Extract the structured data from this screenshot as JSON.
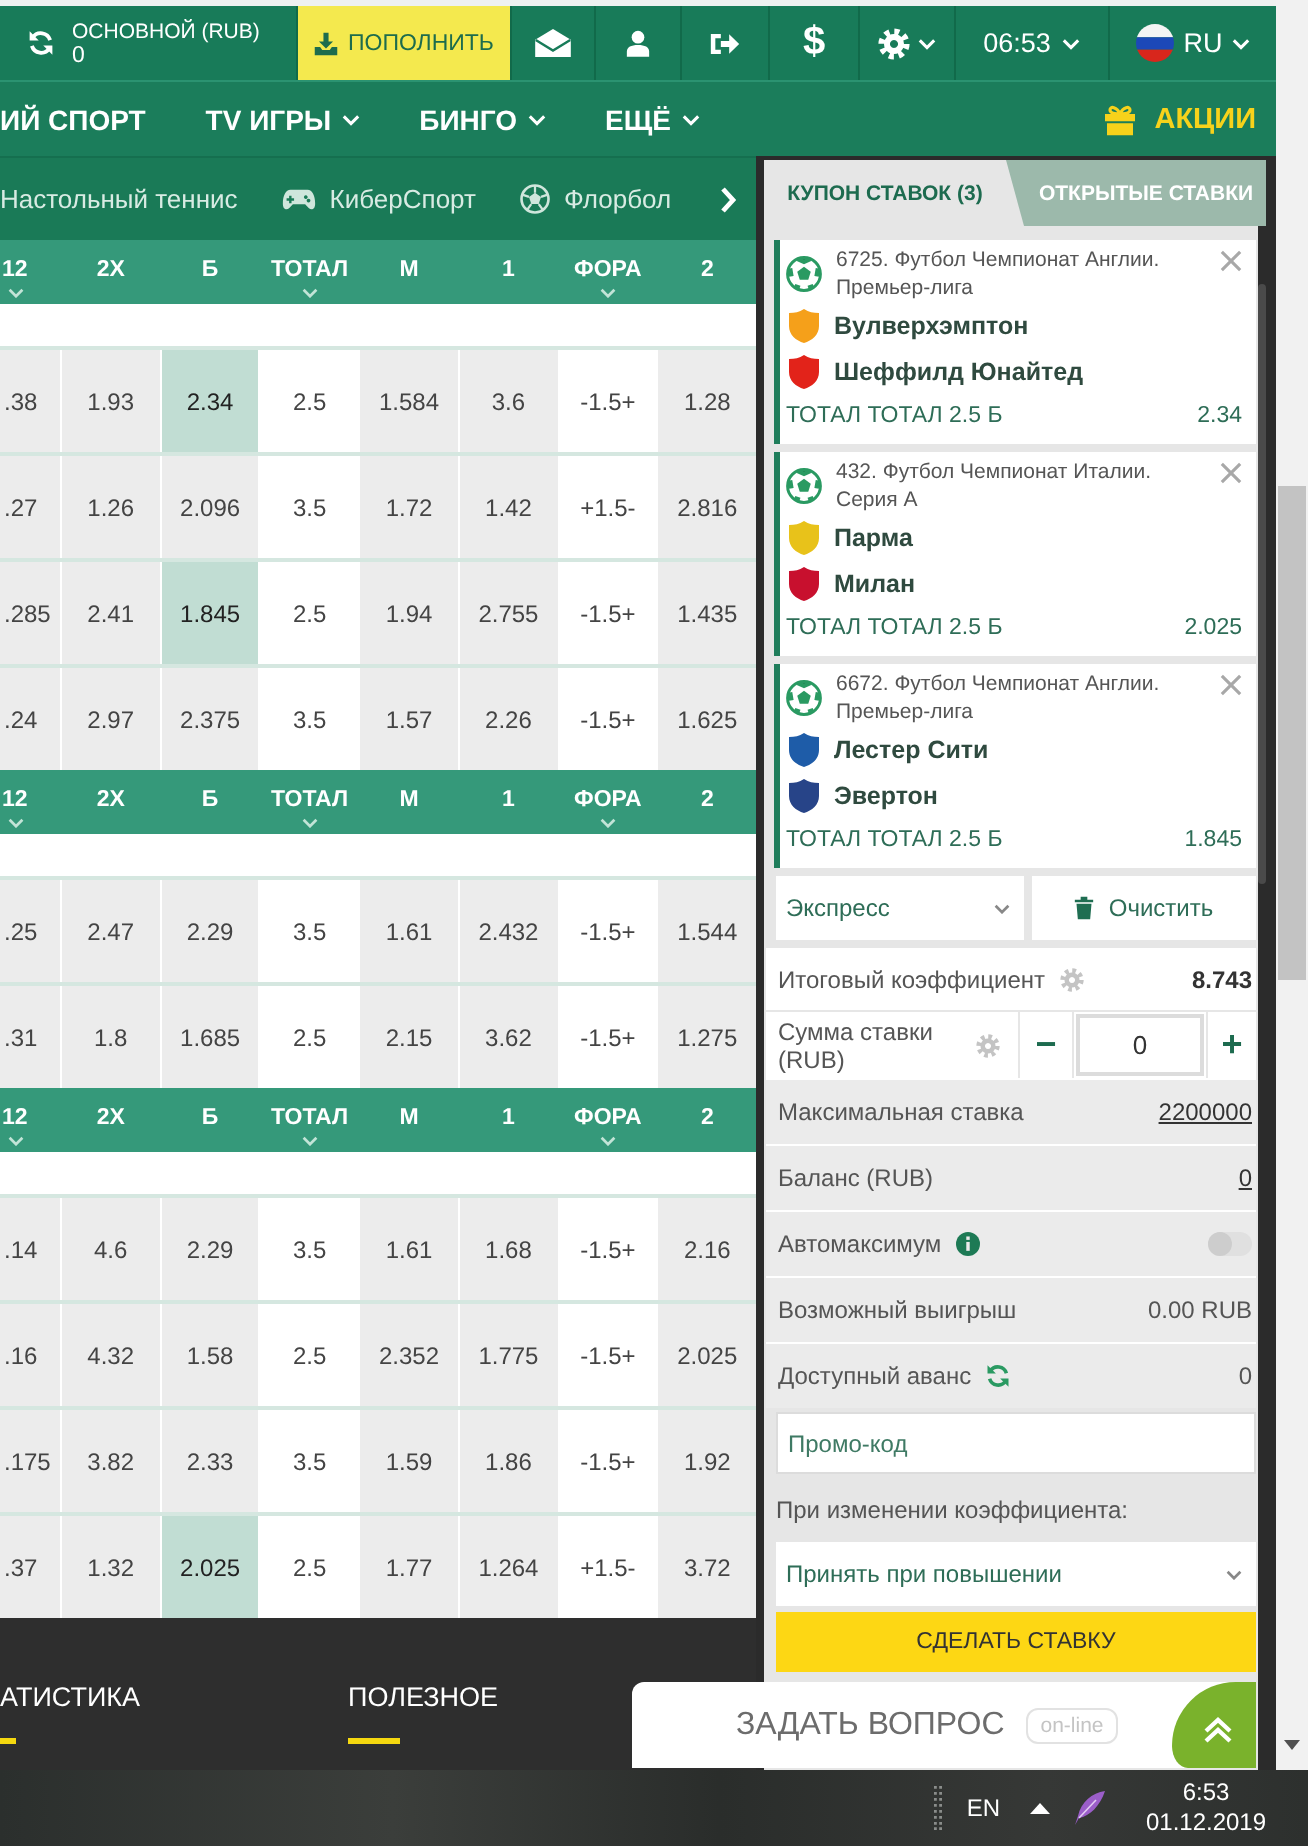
{
  "header": {
    "balance_label": "ОСНОВНОЙ (RUB)",
    "balance": "0",
    "deposit_button": "ПОПОЛНИТЬ",
    "cashier_button": "$",
    "time": "06:53",
    "language": "RU"
  },
  "nav": {
    "items": [
      {
        "label": "ИЙ СПОРТ",
        "dropdown": false
      },
      {
        "label": "TV ИГРЫ",
        "dropdown": true
      },
      {
        "label": "БИНГО",
        "dropdown": true
      },
      {
        "label": "ЕЩЁ",
        "dropdown": true
      }
    ],
    "promotions": "АКЦИИ"
  },
  "sports_tabs": [
    {
      "label": "Настольный теннис"
    },
    {
      "label": "КиберСпорт"
    },
    {
      "label": "Флорбол"
    }
  ],
  "odds_table": {
    "groups": [
      {
        "columns": [
          {
            "label": "12",
            "kind": "odds",
            "dropdown": true
          },
          {
            "label": "2X",
            "kind": "odds",
            "dropdown": false
          },
          {
            "label": "Б",
            "kind": "odds",
            "dropdown": false
          },
          {
            "label": "ТОТАЛ",
            "kind": "param",
            "dropdown": true
          },
          {
            "label": "М",
            "kind": "odds",
            "dropdown": false
          },
          {
            "label": "1",
            "kind": "odds",
            "dropdown": false
          },
          {
            "label": "ФОРА",
            "kind": "param",
            "dropdown": true
          },
          {
            "label": "2",
            "kind": "odds",
            "dropdown": false
          }
        ],
        "rows": [
          {
            "cells": [
              {
                "value": ".38",
                "selected": false
              },
              {
                "value": "1.93",
                "selected": false
              },
              {
                "value": "2.34",
                "selected": true
              },
              {
                "value": "2.5"
              },
              {
                "value": "1.584",
                "selected": false
              },
              {
                "value": "3.6",
                "selected": false
              },
              {
                "value": "-1.5+"
              },
              {
                "value": "1.28",
                "selected": false
              }
            ]
          },
          {
            "cells": [
              {
                "value": ".27",
                "selected": false
              },
              {
                "value": "1.26",
                "selected": false
              },
              {
                "value": "2.096",
                "selected": false
              },
              {
                "value": "3.5"
              },
              {
                "value": "1.72",
                "selected": false
              },
              {
                "value": "1.42",
                "selected": false
              },
              {
                "value": "+1.5-"
              },
              {
                "value": "2.816",
                "selected": false
              }
            ]
          },
          {
            "cells": [
              {
                "value": ".285",
                "selected": false
              },
              {
                "value": "2.41",
                "selected": false
              },
              {
                "value": "1.845",
                "selected": true
              },
              {
                "value": "2.5"
              },
              {
                "value": "1.94",
                "selected": false
              },
              {
                "value": "2.755",
                "selected": false
              },
              {
                "value": "-1.5+"
              },
              {
                "value": "1.435",
                "selected": false
              }
            ]
          },
          {
            "cells": [
              {
                "value": ".24",
                "selected": false
              },
              {
                "value": "2.97",
                "selected": false
              },
              {
                "value": "2.375",
                "selected": false
              },
              {
                "value": "3.5"
              },
              {
                "value": "1.57",
                "selected": false
              },
              {
                "value": "2.26",
                "selected": false
              },
              {
                "value": "-1.5+"
              },
              {
                "value": "1.625",
                "selected": false
              }
            ]
          }
        ]
      },
      {
        "columns": [
          {
            "label": "12",
            "kind": "odds",
            "dropdown": true
          },
          {
            "label": "2X",
            "kind": "odds",
            "dropdown": false
          },
          {
            "label": "Б",
            "kind": "odds",
            "dropdown": false
          },
          {
            "label": "ТОТАЛ",
            "kind": "param",
            "dropdown": true
          },
          {
            "label": "М",
            "kind": "odds",
            "dropdown": false
          },
          {
            "label": "1",
            "kind": "odds",
            "dropdown": false
          },
          {
            "label": "ФОРА",
            "kind": "param",
            "dropdown": true
          },
          {
            "label": "2",
            "kind": "odds",
            "dropdown": false
          }
        ],
        "rows": [
          {
            "cells": [
              {
                "value": ".25",
                "selected": false
              },
              {
                "value": "2.47",
                "selected": false
              },
              {
                "value": "2.29",
                "selected": false
              },
              {
                "value": "3.5"
              },
              {
                "value": "1.61",
                "selected": false
              },
              {
                "value": "2.432",
                "selected": false
              },
              {
                "value": "-1.5+"
              },
              {
                "value": "1.544",
                "selected": false
              }
            ]
          },
          {
            "cells": [
              {
                "value": ".31",
                "selected": false
              },
              {
                "value": "1.8",
                "selected": false
              },
              {
                "value": "1.685",
                "selected": false
              },
              {
                "value": "2.5"
              },
              {
                "value": "2.15",
                "selected": false
              },
              {
                "value": "3.62",
                "selected": false
              },
              {
                "value": "-1.5+"
              },
              {
                "value": "1.275",
                "selected": false
              }
            ]
          }
        ]
      },
      {
        "columns": [
          {
            "label": "12",
            "kind": "odds",
            "dropdown": true
          },
          {
            "label": "2X",
            "kind": "odds",
            "dropdown": false
          },
          {
            "label": "Б",
            "kind": "odds",
            "dropdown": false
          },
          {
            "label": "ТОТАЛ",
            "kind": "param",
            "dropdown": true
          },
          {
            "label": "М",
            "kind": "odds",
            "dropdown": false
          },
          {
            "label": "1",
            "kind": "odds",
            "dropdown": false
          },
          {
            "label": "ФОРА",
            "kind": "param",
            "dropdown": true
          },
          {
            "label": "2",
            "kind": "odds",
            "dropdown": false
          }
        ],
        "rows": [
          {
            "cells": [
              {
                "value": ".14",
                "selected": false
              },
              {
                "value": "4.6",
                "selected": false
              },
              {
                "value": "2.29",
                "selected": false
              },
              {
                "value": "3.5"
              },
              {
                "value": "1.61",
                "selected": false
              },
              {
                "value": "1.68",
                "selected": false
              },
              {
                "value": "-1.5+"
              },
              {
                "value": "2.16",
                "selected": false
              }
            ]
          },
          {
            "cells": [
              {
                "value": ".16",
                "selected": false
              },
              {
                "value": "4.32",
                "selected": false
              },
              {
                "value": "1.58",
                "selected": false
              },
              {
                "value": "2.5"
              },
              {
                "value": "2.352",
                "selected": false
              },
              {
                "value": "1.775",
                "selected": false
              },
              {
                "value": "-1.5+"
              },
              {
                "value": "2.025",
                "selected": false
              }
            ]
          },
          {
            "cells": [
              {
                "value": ".175",
                "selected": false
              },
              {
                "value": "3.82",
                "selected": false
              },
              {
                "value": "2.33",
                "selected": false
              },
              {
                "value": "3.5"
              },
              {
                "value": "1.59",
                "selected": false
              },
              {
                "value": "1.86",
                "selected": false
              },
              {
                "value": "-1.5+"
              },
              {
                "value": "1.92",
                "selected": false
              }
            ]
          },
          {
            "cells": [
              {
                "value": ".37",
                "selected": false
              },
              {
                "value": "1.32",
                "selected": false
              },
              {
                "value": "2.025",
                "selected": true
              },
              {
                "value": "2.5"
              },
              {
                "value": "1.77",
                "selected": false
              },
              {
                "value": "1.264",
                "selected": false
              },
              {
                "value": "+1.5-"
              },
              {
                "value": "3.72",
                "selected": false
              }
            ]
          }
        ]
      }
    ]
  },
  "footer": {
    "links": [
      "АТИСТИКА",
      "ПОЛЕЗНОЕ"
    ]
  },
  "coupon": {
    "tabs": [
      {
        "label": "КУПОН СТАВОК (3)",
        "selected": true
      },
      {
        "label": "ОТКРЫТЫЕ СТАВКИ",
        "selected": false
      }
    ],
    "bets": [
      {
        "event": "6725. Футбол Чемпионат Англии. Премьер-лига",
        "teams": [
          {
            "name": "Вулверхэмптон",
            "color": "#f5a01a"
          },
          {
            "name": "Шеффилд Юнайтед",
            "color": "#e2231a"
          }
        ],
        "market": "ТОТАЛ ТОТАЛ 2.5 Б",
        "odds": "2.34"
      },
      {
        "event": "432. Футбол Чемпионат Италии. Серия А",
        "teams": [
          {
            "name": "Парма",
            "color": "#e8c21a"
          },
          {
            "name": "Милан",
            "color": "#c8102e"
          }
        ],
        "market": "ТОТАЛ ТОТАЛ 2.5 Б",
        "odds": "2.025"
      },
      {
        "event": "6672. Футбол Чемпионат Англии. Премьер-лига",
        "teams": [
          {
            "name": "Лестер Сити",
            "color": "#1e5ca8"
          },
          {
            "name": "Эвертон",
            "color": "#274488"
          }
        ],
        "market": "ТОТАЛ ТОТАЛ 2.5 Б",
        "odds": "1.845"
      }
    ],
    "bet_type": "Экспресс",
    "clear_button": "Очистить",
    "total_odds": {
      "label": "Итоговый коэффициент",
      "value": "8.743"
    },
    "stake": {
      "label": "Сумма ставки (RUB)",
      "decrease": "−",
      "value": "0",
      "increase": "+"
    },
    "details": [
      {
        "kind": "link",
        "label": "Максимальная ставка",
        "value": "2200000"
      },
      {
        "kind": "link",
        "label": "Баланс (RUB)",
        "value": "0"
      },
      {
        "kind": "toggle",
        "label": "Автомаксимум",
        "on": false
      },
      {
        "kind": "text",
        "label": "Возможный выигрыш",
        "value": "0.00 RUB"
      },
      {
        "kind": "refresh",
        "label": "Доступный аванс",
        "value": "0"
      }
    ],
    "promo_code": {
      "placeholder": "Промо-код"
    },
    "odds_change": {
      "label": "При изменении коэффициента:",
      "value": "Принять при повышении"
    },
    "submit_button": "СДЕЛАТЬ СТАВКУ"
  },
  "chat": {
    "label": "ЗАДАТЬ ВОПРОС",
    "status": "on-line"
  },
  "taskbar": {
    "language": "EN",
    "time": "6:53",
    "date": "01.12.2019"
  }
}
